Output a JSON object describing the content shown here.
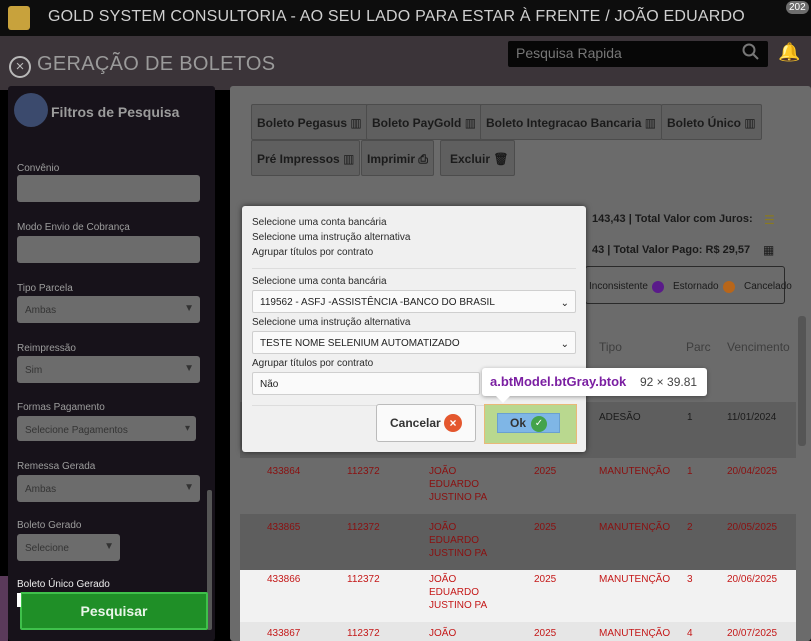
{
  "app": {
    "title": "GOLD SYSTEM CONSULTORIA - AO SEU LADO PARA ESTAR À FRENTE / JOÃO EDUARDO",
    "badge": "202"
  },
  "header": {
    "page_title": "GERAÇÃO DE BOLETOS",
    "search_placeholder": "Pesquisa Rapida"
  },
  "sidebar": {
    "title": "Filtros de Pesquisa",
    "fields": [
      {
        "label": "Convênio",
        "value": ""
      },
      {
        "label": "Modo Envio de Cobrança",
        "value": ""
      },
      {
        "label": "Tipo Parcela",
        "value": "Ambas"
      },
      {
        "label": "Reimpressão",
        "value": "Sim"
      },
      {
        "label": "Formas Pagamento",
        "value": "Selecione Pagamentos"
      },
      {
        "label": "Remessa Gerada",
        "value": "Ambas"
      },
      {
        "label": "Boleto Gerado",
        "value": "Selecione"
      },
      {
        "label": "Boleto Único Gerado",
        "value": ""
      }
    ],
    "search_button": "Pesquisar"
  },
  "toolbar": {
    "buttons": [
      "Boleto Pegasus",
      "Boleto PayGold",
      "Boleto Integracao Bancaria",
      "Boleto Único",
      "Pré Impressos",
      "Imprimir",
      "Excluir"
    ]
  },
  "summary": {
    "line1": "143,43 | Total Valor com Juros:",
    "line2": "43 | Total Valor Pago: R$ 29,57"
  },
  "legend": {
    "inconsistente": "Inconsistente",
    "estornado": "Estornado",
    "cancelado": "Cancelado"
  },
  "table": {
    "headers": {
      "tipo": "Tipo",
      "parc": "Parc",
      "venc": "Vencimento"
    },
    "rows": [
      {
        "tipo": "ADESÃO",
        "parc": "1",
        "venc": "11/01/2024"
      },
      {
        "id": "433864",
        "cod": "112372",
        "nome": [
          "JOÃO",
          "EDUARDO",
          "JUSTINO PA"
        ],
        "ano": "2025",
        "tipo": "MANUTENÇÃO",
        "parc": "1",
        "venc": "20/04/2025"
      },
      {
        "id": "433865",
        "cod": "112372",
        "nome": [
          "JOÃO",
          "EDUARDO",
          "JUSTINO PA"
        ],
        "ano": "2025",
        "tipo": "MANUTENÇÃO",
        "parc": "2",
        "venc": "20/05/2025"
      },
      {
        "id": "433866",
        "cod": "112372",
        "nome": [
          "JOÃO",
          "EDUARDO",
          "JUSTINO PA"
        ],
        "ano": "2025",
        "tipo": "MANUTENÇÃO",
        "parc": "3",
        "venc": "20/06/2025"
      },
      {
        "id": "433867",
        "cod": "112372",
        "nome": [
          "JOÃO"
        ],
        "ano": "2025",
        "tipo": "MANUTENÇÃO",
        "parc": "4",
        "venc": "20/07/2025"
      }
    ]
  },
  "dialog": {
    "summary": [
      "Selecione uma conta bancária",
      "Selecione uma instrução alternativa",
      "Agrupar títulos por contrato"
    ],
    "account_label": "Selecione uma conta bancária",
    "account_value": "119562 - ASFJ -ASSISTÊNCIA -BANCO DO BRASIL",
    "instruction_label": "Selecione uma instrução alternativa",
    "instruction_value": "TESTE NOME SELENIUM AUTOMATIZADO",
    "group_label": "Agrupar títulos por contrato",
    "group_value": "Não",
    "cancel_label": "Cancelar",
    "ok_label": "Ok"
  },
  "tooltip": {
    "selector": "a.btModel.btGray.btok",
    "size": "92 × 39.81"
  },
  "colors": {
    "accent_green": "#1f8f27",
    "danger_red": "#e4572e",
    "ok_blue": "#7fb6e6",
    "tooltip_purple": "#7b1fa2"
  }
}
